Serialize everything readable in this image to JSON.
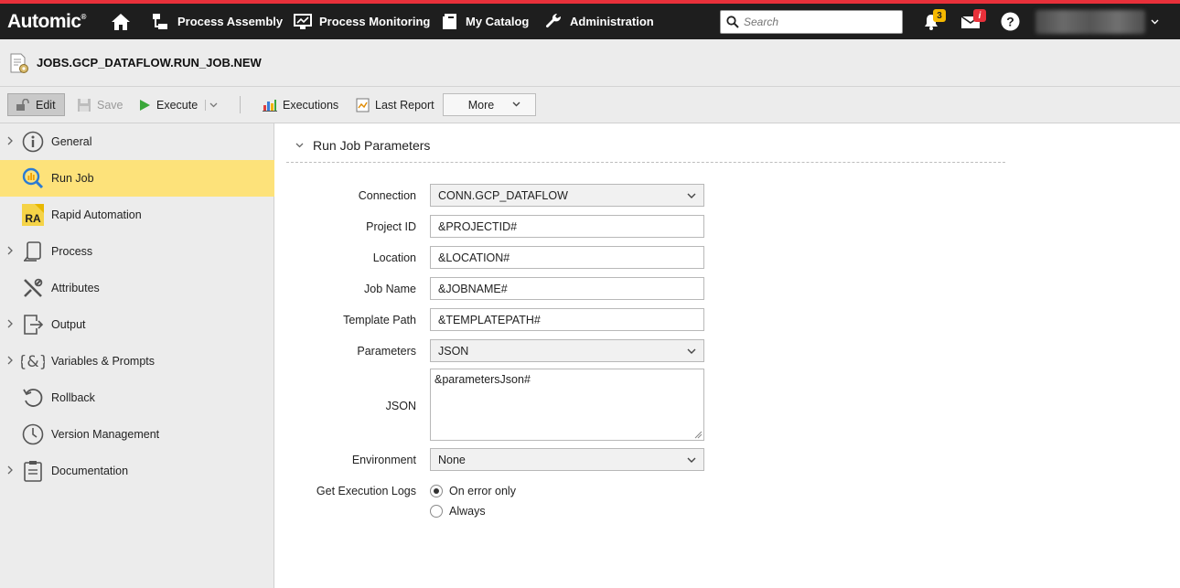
{
  "nav": {
    "logo": "Automic",
    "logo_mark": "®",
    "items": [
      {
        "label": "Process Assembly",
        "icon": "process-assembly-icon"
      },
      {
        "label": "Process Monitoring",
        "icon": "monitor-icon"
      },
      {
        "label": "My Catalog",
        "icon": "catalog-icon"
      },
      {
        "label": "Administration",
        "icon": "wrench-icon"
      }
    ],
    "search_placeholder": "Search",
    "notifications_count": "3",
    "messages_badge": "i"
  },
  "object": {
    "title": "JOBS.GCP_DATAFLOW.RUN_JOB.NEW"
  },
  "toolbar": {
    "edit": "Edit",
    "save": "Save",
    "execute": "Execute",
    "executions": "Executions",
    "last_report": "Last Report",
    "more": "More"
  },
  "sidebar": {
    "items": [
      {
        "label": "General",
        "icon": "info-icon",
        "expandable": true
      },
      {
        "label": "Run Job",
        "icon": "run-job-icon",
        "active": true
      },
      {
        "label": "Rapid Automation",
        "icon": "ra-icon"
      },
      {
        "label": "Process",
        "icon": "process-icon",
        "expandable": true
      },
      {
        "label": "Attributes",
        "icon": "attributes-icon"
      },
      {
        "label": "Output",
        "icon": "output-icon",
        "expandable": true
      },
      {
        "label": "Variables & Prompts",
        "icon": "variables-icon",
        "expandable": true
      },
      {
        "label": "Rollback",
        "icon": "rollback-icon"
      },
      {
        "label": "Version Management",
        "icon": "clock-icon"
      },
      {
        "label": "Documentation",
        "icon": "clipboard-icon",
        "expandable": true
      }
    ],
    "ra_text": "RA"
  },
  "form": {
    "section_title": "Run Job Parameters",
    "connection": {
      "label": "Connection",
      "value": "CONN.GCP_DATAFLOW"
    },
    "project_id": {
      "label": "Project ID",
      "value": "&PROJECTID#"
    },
    "location": {
      "label": "Location",
      "value": "&LOCATION#"
    },
    "job_name": {
      "label": "Job Name",
      "value": "&JOBNAME#"
    },
    "template_path": {
      "label": "Template Path",
      "value": "&TEMPLATEPATH#"
    },
    "parameters": {
      "label": "Parameters",
      "value": "JSON"
    },
    "json": {
      "label": "JSON",
      "value": "&parametersJson#"
    },
    "environment": {
      "label": "Environment",
      "value": "None"
    },
    "execution_logs": {
      "label": "Get Execution Logs",
      "options": [
        "On error only",
        "Always"
      ],
      "selected": "On error only"
    }
  },
  "colors": {
    "nav_bg": "#1e1e1e",
    "accent_red": "#e8303a",
    "active_item": "#fde27a",
    "badge_yellow": "#f5b800",
    "badge_red": "#e8303a"
  }
}
